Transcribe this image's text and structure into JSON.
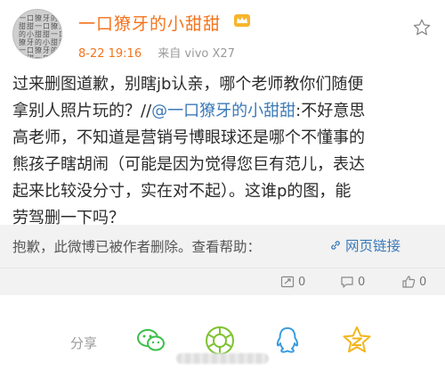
{
  "post": {
    "username": "一口獠牙的小甜甜",
    "timestamp": "8-22 19:16",
    "source": "来自 vivo X27",
    "avatar_chars": [
      "一",
      "口",
      "獠",
      "牙",
      "的",
      "小",
      "甜",
      "甜",
      "一",
      "口",
      "獠",
      "牙",
      "的",
      "小",
      "甜",
      "甜",
      "一",
      "口",
      "獠",
      "牙",
      "的",
      "小",
      "甜",
      "甜",
      "一",
      "口",
      "獠",
      "牙",
      "的",
      "小",
      "甜",
      "甜",
      "一",
      "口",
      "獠",
      "牙"
    ],
    "content": {
      "line1": "过来删图道歉，别瞎jb认亲，哪个老师教你们随便",
      "line2_before": "拿别人照片玩的？//",
      "line2_mention": "@一口獠牙的小甜甜",
      "line2_after": ":不好意思",
      "line3": "高老师，不知道是营销号博眼球还是哪个不懂事的",
      "line4": "熊孩子瞎胡闹（可能是因为觉得您巨有范儿，表达",
      "line5": "起来比较没分寸，实在对不起）。这谁p的图，能",
      "line6": "劳驾删一下吗？"
    }
  },
  "deleted": {
    "text": "抱歉，此微博已被作者删除。查看帮助：",
    "link": "网页链接"
  },
  "actions": {
    "repost_count": "0",
    "comment_count": "0",
    "like_count": "0"
  },
  "share": {
    "label": "分享"
  },
  "colors": {
    "username": "#f4731c",
    "link": "#3d7ab8"
  }
}
